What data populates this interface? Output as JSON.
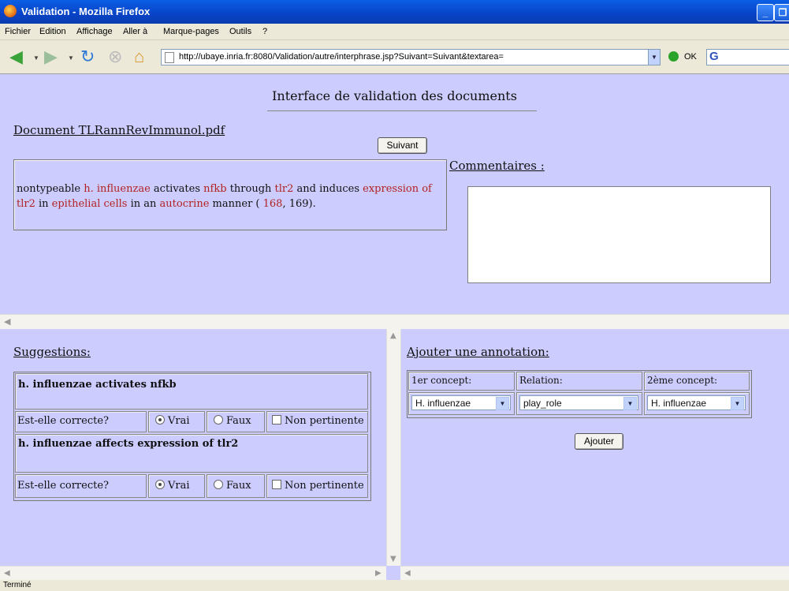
{
  "window": {
    "title": "Validation - Mozilla Firefox",
    "buttons": [
      "_",
      "❐"
    ]
  },
  "menu": [
    "Fichier",
    "Edition",
    "Affichage",
    "Aller à",
    "Marque-pages",
    "Outils",
    "?"
  ],
  "nav": {
    "url": "http://ubaye.inria.fr:8080/Validation/autre/interphrase.jsp?Suivant=Suivant&textarea=",
    "go_label": "OK",
    "search_logo": "G"
  },
  "page": {
    "title": "Interface de validation des documents",
    "document_label": "Document TLRannRevImmunol.pdf",
    "next_button": "Suivant",
    "comments_label": "Commentaires :",
    "sentence_parts": [
      {
        "text": "nontypeable ",
        "hl": false
      },
      {
        "text": "h. influenzae",
        "hl": true
      },
      {
        "text": " activates ",
        "hl": false
      },
      {
        "text": "nfkb",
        "hl": true
      },
      {
        "text": " through ",
        "hl": false
      },
      {
        "text": "tlr2",
        "hl": true
      },
      {
        "text": " and induces ",
        "hl": false
      },
      {
        "text": "expression of tlr2",
        "hl": true
      },
      {
        "text": " in ",
        "hl": false
      },
      {
        "text": "epithelial cells",
        "hl": true
      },
      {
        "text": " in an ",
        "hl": false
      },
      {
        "text": "autocrine",
        "hl": true
      },
      {
        "text": " manner ( ",
        "hl": false
      },
      {
        "text": "168",
        "hl": true
      },
      {
        "text": ", 169).",
        "hl": false
      }
    ]
  },
  "suggestions": {
    "label": "Suggestions:",
    "items": [
      {
        "text": "h. influenzae activates nfkb",
        "question": "Est-elle correcte?",
        "opt_true": "Vrai",
        "opt_false": "Faux",
        "opt_np": "Non pertinente",
        "selected": "Vrai"
      },
      {
        "text": "h. influenzae affects expression of tlr2",
        "question": "Est-elle correcte?",
        "opt_true": "Vrai",
        "opt_false": "Faux",
        "opt_np": "Non pertinente",
        "selected": "Vrai"
      }
    ]
  },
  "annotation": {
    "label": "Ajouter une annotation:",
    "col1": "1er concept:",
    "col2": "Relation:",
    "col3": "2ème concept:",
    "concept1": "H. influenzae",
    "relation": "play_role",
    "concept2": "H. influenzae",
    "add_button": "Ajouter"
  },
  "status": "Terminé",
  "colors": {
    "highlight": "#b22222",
    "page_bg": "#ccccff",
    "titlebar": "#0843c6"
  }
}
